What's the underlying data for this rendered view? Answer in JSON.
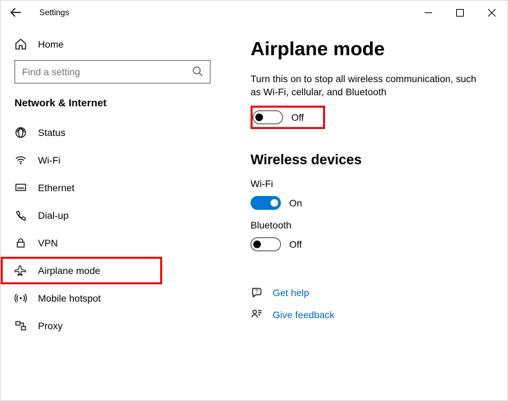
{
  "window": {
    "title": "Settings"
  },
  "sidebar": {
    "home": "Home",
    "searchPlaceholder": "Find a setting",
    "category": "Network & Internet",
    "items": [
      {
        "label": "Status"
      },
      {
        "label": "Wi-Fi"
      },
      {
        "label": "Ethernet"
      },
      {
        "label": "Dial-up"
      },
      {
        "label": "VPN"
      },
      {
        "label": "Airplane mode"
      },
      {
        "label": "Mobile hotspot"
      },
      {
        "label": "Proxy"
      }
    ]
  },
  "page": {
    "heading": "Airplane mode",
    "description": "Turn this on to stop all wireless communication, such as Wi-Fi, cellular, and Bluetooth",
    "airplaneStatus": "Off",
    "wirelessHeading": "Wireless devices",
    "wifiLabel": "Wi-Fi",
    "wifiStatus": "On",
    "btLabel": "Bluetooth",
    "btStatus": "Off",
    "helpLabel": "Get help",
    "feedbackLabel": "Give feedback"
  }
}
